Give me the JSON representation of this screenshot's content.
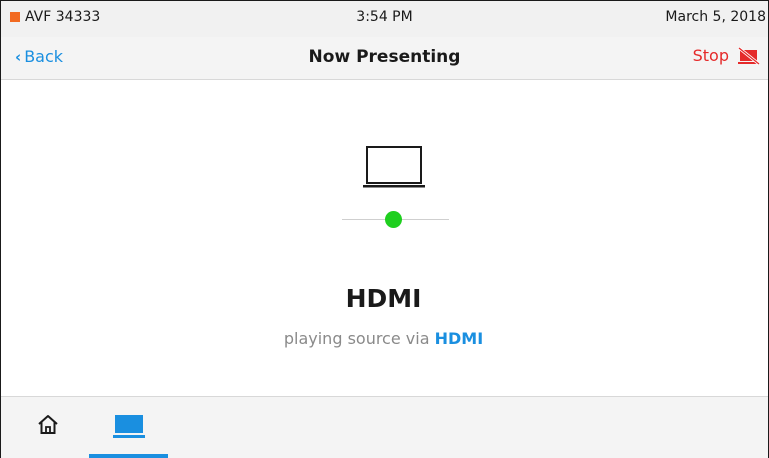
{
  "status_bar": {
    "room_name": "AVF 34333",
    "time": "3:54 PM",
    "date": "March 5, 2018",
    "indicator_color": "#f26a21"
  },
  "nav": {
    "back_label": "Back",
    "title": "Now Presenting",
    "stop_label": "Stop"
  },
  "main": {
    "icon": "laptop-icon",
    "status_color": "#1fcf1f",
    "source_title": "HDMI",
    "caption_prefix": "playing source via",
    "caption_source": "HDMI"
  },
  "bottom_bar": {
    "items": [
      {
        "icon": "home-icon",
        "selected": false
      },
      {
        "icon": "laptop-icon",
        "selected": true
      }
    ],
    "accent_color": "#1a8fe0"
  }
}
